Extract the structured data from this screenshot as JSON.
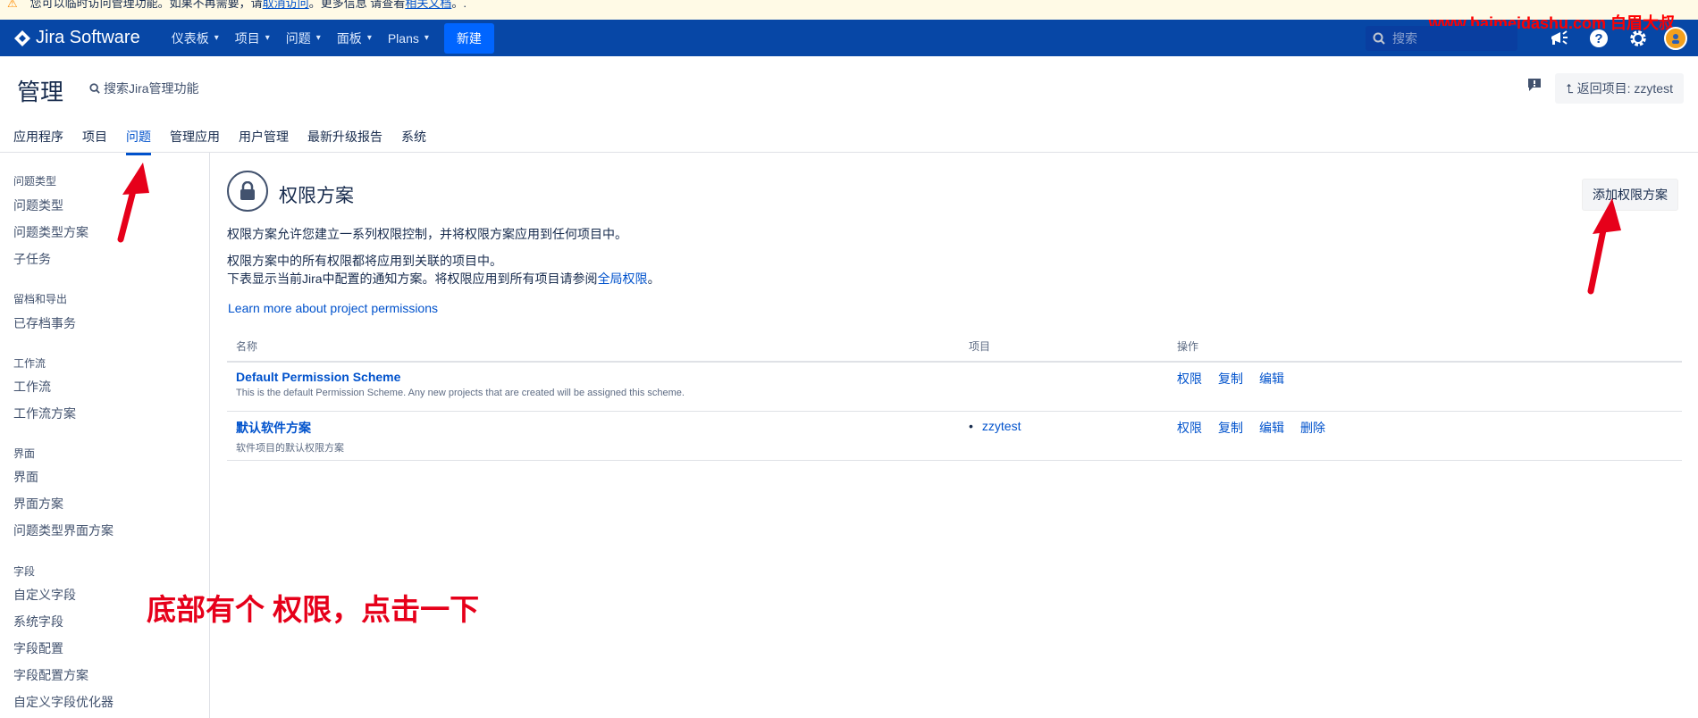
{
  "banner": {
    "text": "您可以临时访问管理功能。如果不再需要，请",
    "link1": "取消访问",
    "mid": "。更多信息 请查看",
    "link2": "相关文档",
    "tail": "。."
  },
  "topnav": {
    "logo": "Jira Software",
    "items": [
      {
        "label": "仪表板"
      },
      {
        "label": "项目"
      },
      {
        "label": "问题"
      },
      {
        "label": "面板"
      },
      {
        "label": "Plans"
      }
    ],
    "create_label": "新建",
    "search_placeholder": "搜索",
    "watermark": "www.baimeidashu.com 白眉大叔"
  },
  "admin": {
    "title": "管理",
    "search_label": "搜索Jira管理功能",
    "back_label": "返回项目: zzytest",
    "tabs": [
      "应用程序",
      "项目",
      "问题",
      "管理应用",
      "用户管理",
      "最新升级报告",
      "系统"
    ],
    "active_tab": "问题"
  },
  "sidebar": {
    "groups": [
      {
        "title": "问题类型",
        "items": [
          "问题类型",
          "问题类型方案",
          "子任务"
        ]
      },
      {
        "title": "留档和导出",
        "items": [
          "已存档事务"
        ]
      },
      {
        "title": "工作流",
        "items": [
          "工作流",
          "工作流方案"
        ]
      },
      {
        "title": "界面",
        "items": [
          "界面",
          "界面方案",
          "问题类型界面方案"
        ]
      },
      {
        "title": "字段",
        "items": [
          "自定义字段",
          "系统字段",
          "字段配置",
          "字段配置方案",
          "自定义字段优化器"
        ]
      }
    ]
  },
  "main": {
    "title": "权限方案",
    "add_label": "添加权限方案",
    "desc1": "权限方案允许您建立一系列权限控制，并将权限方案应用到任何项目中。",
    "desc2": "权限方案中的所有权限都将应用到关联的项目中。",
    "desc3": "下表显示当前Jira中配置的通知方案。将权限应用到所有项目请参阅",
    "desc3_link": "全局权限",
    "desc3_tail": "。",
    "learn_more": "Learn more about project permissions",
    "table": {
      "headers": [
        "名称",
        "项目",
        "操作"
      ],
      "rows": [
        {
          "name": "Default Permission Scheme",
          "desc": "This is the default Permission Scheme. Any new projects that are created will be assigned this scheme.",
          "projects": [],
          "ops": [
            "权限",
            "复制",
            "编辑"
          ]
        },
        {
          "name": "默认软件方案",
          "desc": "软件项目的默认权限方案",
          "projects": [
            "zzytest"
          ],
          "ops": [
            "权限",
            "复制",
            "编辑",
            "删除"
          ]
        }
      ]
    }
  },
  "annotation": "底部有个 权限，点击一下",
  "colors": {
    "nav_bg": "#0747a6",
    "create_btn": "#0065ff",
    "link": "#0052cc",
    "annotation": "#e6001a"
  }
}
